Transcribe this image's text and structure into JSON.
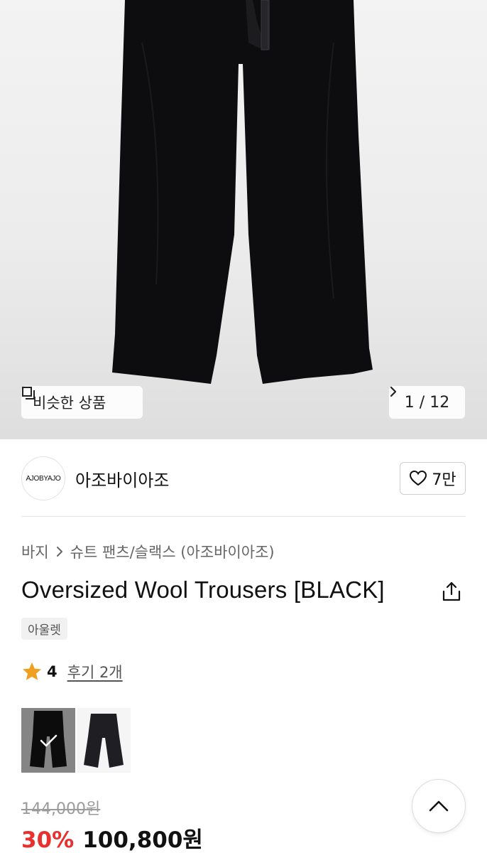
{
  "gallery": {
    "similar_label": "비슷한 상품",
    "counter": "1 / 12"
  },
  "brand": {
    "logo_text": "AJOBYAJO",
    "name": "아조바이아조",
    "likes": "7만"
  },
  "breadcrumb": {
    "category": "바지",
    "subcategory": "슈트 팬츠/슬랙스 (아조바이아조)"
  },
  "product": {
    "title": "Oversized Wool Trousers [BLACK]",
    "tag": "아울렛",
    "rating": "4",
    "reviews": "후기 2개",
    "original_price": "144,000원",
    "discount": "30%",
    "price": "100,800원"
  },
  "colors": {
    "accent": "#e8302e",
    "star": "#f0a020"
  },
  "icons": [
    "similar-icon",
    "chevron-right-icon",
    "heart-icon",
    "share-icon",
    "star-icon",
    "check-icon",
    "chevron-up-icon"
  ]
}
